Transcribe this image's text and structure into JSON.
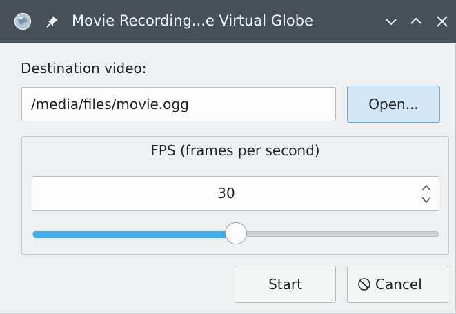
{
  "window": {
    "title": "Movie Recording...e Virtual Globe",
    "app_icon": "globe-icon",
    "pin_icon": "pin-icon",
    "controls": [
      "minimize-icon",
      "maximize-icon",
      "close-icon"
    ]
  },
  "destination": {
    "label": "Destination video:",
    "path": "/media/files/movie.ogg",
    "open_label": "Open..."
  },
  "fps": {
    "group_title": "FPS (frames per second)",
    "value": "30",
    "slider_fraction": 0.5
  },
  "actions": {
    "start_label": "Start",
    "cancel_label": "Cancel",
    "cancel_icon": "cancel-icon"
  },
  "colors": {
    "titlebar": "#475057",
    "accent": "#3daee9",
    "open_button_bg": "#d2e6f5"
  }
}
